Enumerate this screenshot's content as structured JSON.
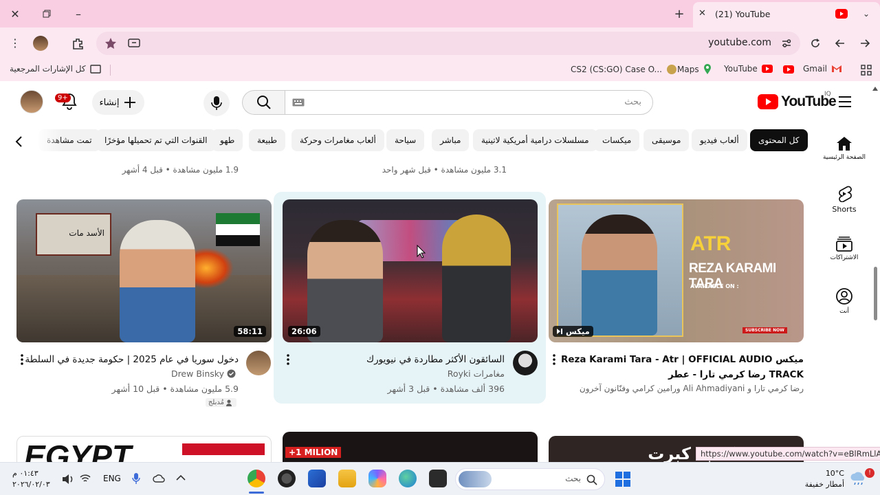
{
  "browser": {
    "tab_title": "(21) YouTube",
    "url": "youtube.com",
    "status_url": "https://www.youtube.com/watch?v=eBlRmLlAJyo"
  },
  "bookmarks": {
    "all_bookmarks": "كل الإشارات المرجعية",
    "items": [
      "CS2 (CS:GO) Case O...",
      "Maps",
      "YouTube",
      "Gmail"
    ]
  },
  "header": {
    "logo_text": "YouTube",
    "country_code": "IQ",
    "search_placeholder": "بحث",
    "create_label": "إنشاء",
    "notif_count": "9+"
  },
  "chips": [
    "كل المحتوى",
    "ألعاب فيديو",
    "موسيقى",
    "ميكسات",
    "مسلسلات درامية أمريكية لاتينية",
    "مباشر",
    "سياحة",
    "ألعاب مغامرات وحركة",
    "طبيعة",
    "طهو",
    "القنوات التي تم تحميلها مؤخرًا",
    "تمت مشاهدة"
  ],
  "nav": {
    "home": "الصفحة الرئيسية",
    "shorts": "Shorts",
    "subscriptions": "الاشتراكات",
    "you": "أنت"
  },
  "top_meta": {
    "left": "1.9 مليون مشاهدة • قبل 4 أشهر",
    "middle": "3.1 مليون مشاهدة • قبل شهر واحد"
  },
  "videos": [
    {
      "title": "دخول سوريا في عام 2025 | حكومة جديدة في السلطة",
      "channel": "Drew Binsky",
      "meta": "5.9 مليون مشاهدة • قبل 10 أشهر",
      "badge": "مُدبلج",
      "duration": "58:11",
      "thumb_caption": "الأسد مات"
    },
    {
      "title": "السائقون الأكثر مطاردة في نيويورك",
      "channel": "Royki",
      "channel_sub": "مغامرات",
      "meta": "396 ألف مشاهدة • قبل 3 أشهر",
      "duration": "26:06"
    },
    {
      "title_line1": "ميكس Reza Karami Tara - Atr | OFFICIAL AUDIO",
      "title_line2": "TRACK رضا كرمي تارا - عطر",
      "channel": "رضا كرمي تارا و Ali Ahmadiyani ورامين كرامي وفنّانون آخرون",
      "duration": "ميكس",
      "thumb_big": "ATR",
      "thumb_name": "REZA KARAMI TARA",
      "thumb_available": "AVAILABLE ON :",
      "thumb_sub": "SUBSCRIBE NOW"
    }
  ],
  "bottom_thumbs": {
    "left_text": "EGYPT",
    "middle_text": "+1 MILION",
    "right_text": "كالبد كبرت"
  },
  "taskbar": {
    "search_placeholder": "بحث",
    "lang": "ENG",
    "time": "٠١:٤٣ م",
    "date": "٢٠٢٦/٠٢/٠٣",
    "weather_temp": "10°C",
    "weather_desc": "أمطار خفيفة"
  },
  "colors": {
    "youtube_red": "#ff0000",
    "title_bar": "#f9cde2",
    "chip_active": "#0f0f0f"
  }
}
